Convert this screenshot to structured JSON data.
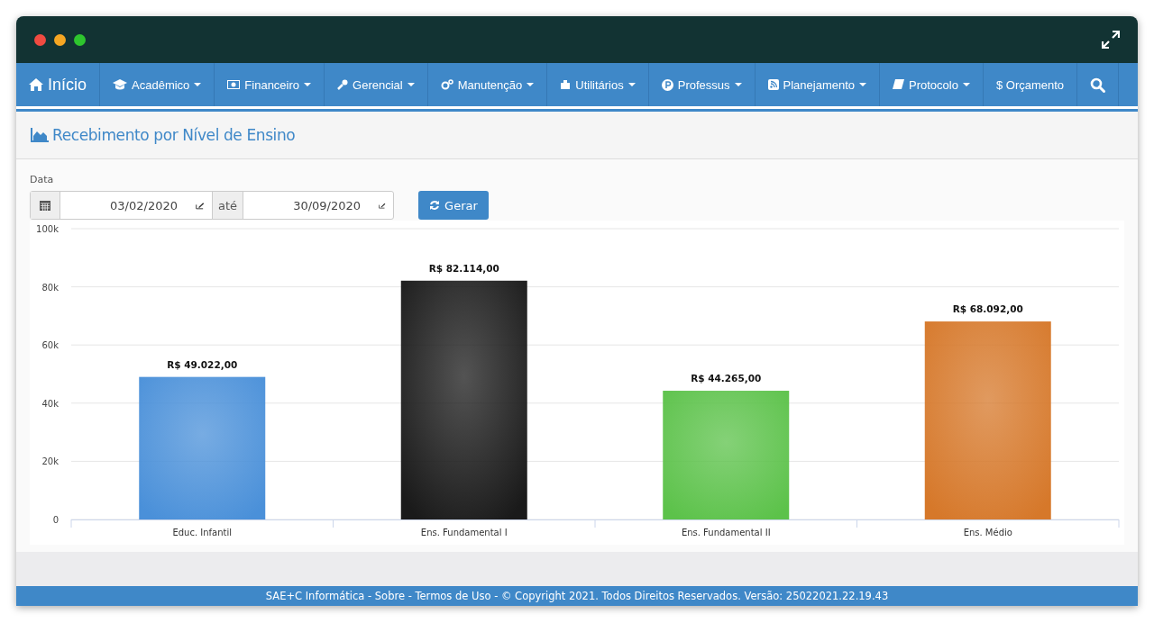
{
  "nav": {
    "items": [
      {
        "label": "Início",
        "dropdown": false
      },
      {
        "label": "Acadêmico",
        "dropdown": true
      },
      {
        "label": "Financeiro",
        "dropdown": true
      },
      {
        "label": "Gerencial",
        "dropdown": true
      },
      {
        "label": "Manutenção",
        "dropdown": true
      },
      {
        "label": "Utilitários",
        "dropdown": true
      },
      {
        "label": "Professus",
        "dropdown": true
      },
      {
        "label": "Planejamento",
        "dropdown": true
      },
      {
        "label": "Protocolo",
        "dropdown": true
      },
      {
        "label": "$ Orçamento",
        "dropdown": false
      }
    ]
  },
  "page": {
    "title": "Recebimento por Nível de Ensino"
  },
  "filter": {
    "label": "Data",
    "from": "03/02/2020",
    "separator": "até",
    "to": "30/09/2020",
    "button": "Gerar"
  },
  "chart_data": {
    "type": "bar",
    "categories": [
      "Educ. Infantil",
      "Ens. Fundamental I",
      "Ens. Fundamental II",
      "Ens. Médio"
    ],
    "series": [
      {
        "values": [
          49022,
          82114,
          44265,
          68092
        ]
      }
    ],
    "ylim": [
      0,
      100000
    ],
    "yticks": [
      {
        "value": 0,
        "label": "0"
      },
      {
        "value": 20000,
        "label": "20k"
      },
      {
        "value": 40000,
        "label": "40k"
      },
      {
        "value": 60000,
        "label": "60k"
      },
      {
        "value": 80000,
        "label": "80k"
      },
      {
        "value": 100000,
        "label": "100k"
      }
    ],
    "grid": true,
    "value_labels": [
      "R$ 49.022,00",
      "R$ 82.114,00",
      "R$ 44.265,00",
      "R$ 68.092,00"
    ]
  },
  "footer": "SAE+C Informática - Sobre - Termos de Uso - © Copyright 2021. Todos Direitos Reservados. Versão: 25022021.22.19.43"
}
